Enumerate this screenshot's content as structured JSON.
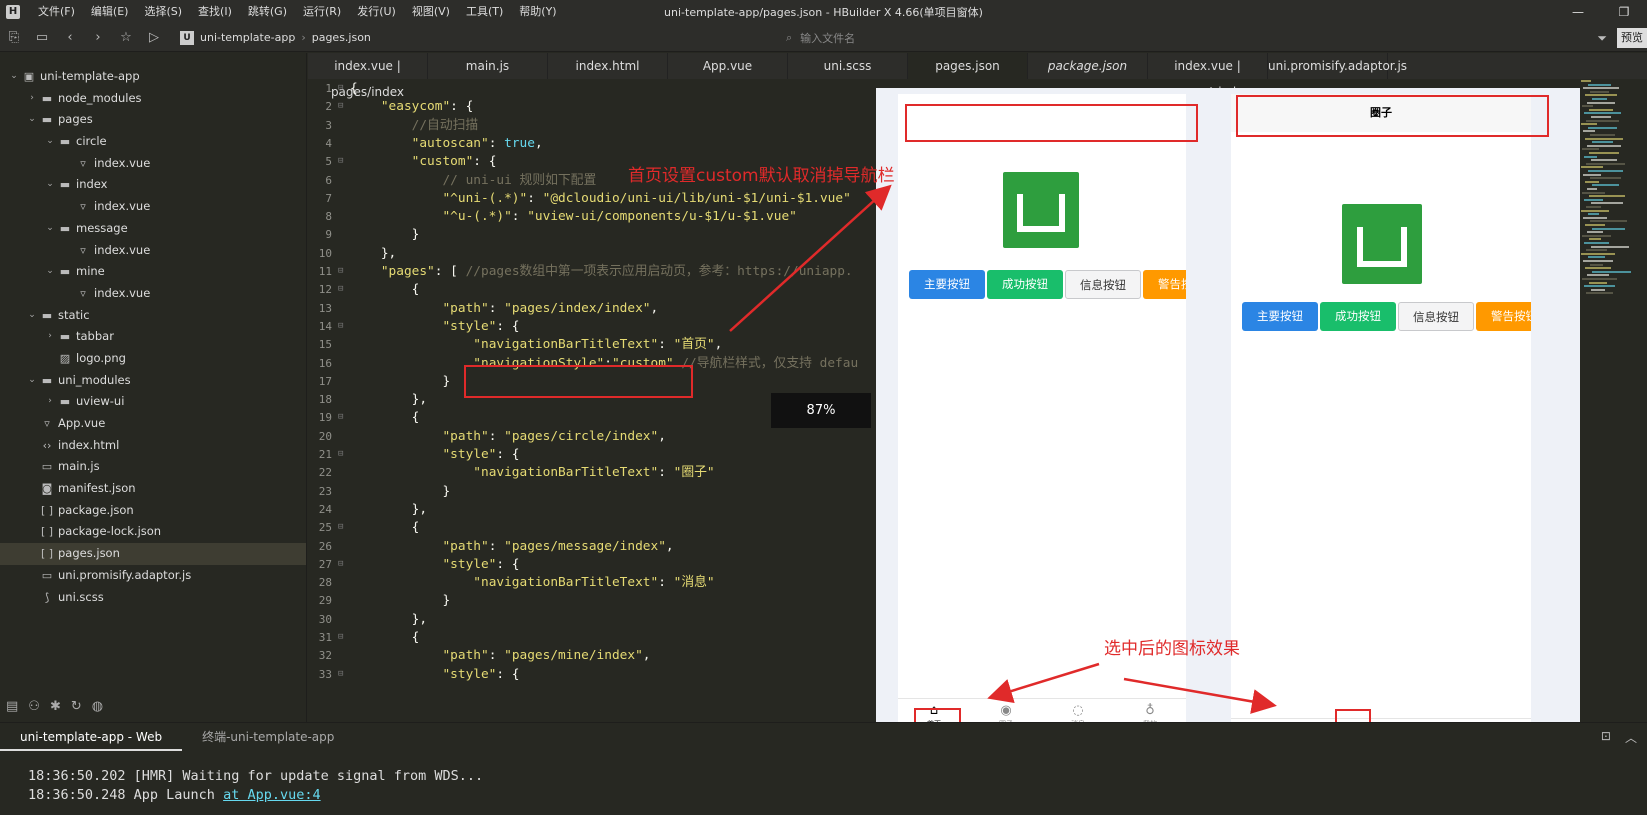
{
  "titlebar": {
    "app_icon": "H",
    "menu": [
      "文件(F)",
      "编辑(E)",
      "选择(S)",
      "查找(I)",
      "跳转(G)",
      "运行(R)",
      "发行(U)",
      "视图(V)",
      "工具(T)",
      "帮助(Y)"
    ],
    "title": "uni-template-app/pages.json - HBuilder X 4.66(单项目窗体)",
    "controls": [
      "—",
      "❐"
    ]
  },
  "toolbar": {
    "breadcrumb": [
      "uni-template-app",
      "pages.json"
    ],
    "search_placeholder": "输入文件名",
    "preview_label": "预览"
  },
  "sidebar": {
    "items": [
      {
        "label": "uni-template-app",
        "type": "project",
        "chevron": "⌄"
      },
      {
        "label": "node_modules",
        "type": "folder",
        "chevron": "›"
      },
      {
        "label": "pages",
        "type": "folder",
        "chevron": "⌄"
      },
      {
        "label": "circle",
        "type": "folder",
        "chevron": "⌄"
      },
      {
        "label": "index.vue",
        "type": "file",
        "icon": "vue"
      },
      {
        "label": "index",
        "type": "folder",
        "chevron": "⌄"
      },
      {
        "label": "index.vue",
        "type": "file",
        "icon": "vue"
      },
      {
        "label": "message",
        "type": "folder",
        "chevron": "⌄"
      },
      {
        "label": "index.vue",
        "type": "file",
        "icon": "vue"
      },
      {
        "label": "mine",
        "type": "folder",
        "chevron": "⌄"
      },
      {
        "label": "index.vue",
        "type": "file",
        "icon": "vue"
      },
      {
        "label": "static",
        "type": "folder",
        "chevron": "⌄"
      },
      {
        "label": "tabbar",
        "type": "folder",
        "chevron": "›"
      },
      {
        "label": "logo.png",
        "type": "file",
        "icon": "image"
      },
      {
        "label": "uni_modules",
        "type": "folder",
        "chevron": "⌄"
      },
      {
        "label": "uview-ui",
        "type": "folder",
        "chevron": "›"
      },
      {
        "label": "App.vue",
        "type": "file",
        "icon": "vue"
      },
      {
        "label": "index.html",
        "type": "file",
        "icon": "html"
      },
      {
        "label": "main.js",
        "type": "file",
        "icon": "js"
      },
      {
        "label": "manifest.json",
        "type": "file",
        "icon": "manifest"
      },
      {
        "label": "package.json",
        "type": "file",
        "icon": "json"
      },
      {
        "label": "package-lock.json",
        "type": "file",
        "icon": "json"
      },
      {
        "label": "pages.json",
        "type": "file",
        "icon": "json",
        "selected": true
      },
      {
        "label": "uni.promisify.adaptor.js",
        "type": "file",
        "icon": "js"
      },
      {
        "label": "uni.scss",
        "type": "file",
        "icon": "scss"
      }
    ]
  },
  "tabs": [
    {
      "label": "index.vue | pages/index"
    },
    {
      "label": "main.js"
    },
    {
      "label": "index.html"
    },
    {
      "label": "App.vue"
    },
    {
      "label": "uni.scss"
    },
    {
      "label": "pages.json",
      "active": true
    },
    {
      "label": "package.json",
      "italic": true
    },
    {
      "label": "index.vue | pages/circle"
    },
    {
      "label": "uni.promisify.adaptor.js"
    }
  ],
  "editor": {
    "lines": [
      {
        "n": "1",
        "fold": "⊟",
        "segs": [
          [
            "p",
            "{"
          ]
        ]
      },
      {
        "n": "2",
        "fold": "⊟",
        "segs": [
          [
            "p",
            "    "
          ],
          [
            "s",
            "\"easycom\""
          ],
          [
            "p",
            ": {"
          ]
        ]
      },
      {
        "n": "3",
        "fold": "",
        "segs": [
          [
            "c",
            "        //自动扫描"
          ]
        ]
      },
      {
        "n": "4",
        "fold": "",
        "segs": [
          [
            "p",
            "        "
          ],
          [
            "s",
            "\"autoscan\""
          ],
          [
            "p",
            ": "
          ],
          [
            "k",
            "true"
          ],
          [
            "p",
            ","
          ]
        ]
      },
      {
        "n": "5",
        "fold": "⊟",
        "segs": [
          [
            "p",
            "        "
          ],
          [
            "s",
            "\"custom\""
          ],
          [
            "p",
            ": {"
          ]
        ]
      },
      {
        "n": "6",
        "fold": "",
        "segs": [
          [
            "c",
            "            // uni-ui 规则如下配置"
          ]
        ]
      },
      {
        "n": "7",
        "fold": "",
        "segs": [
          [
            "p",
            "            "
          ],
          [
            "s",
            "\"^uni-(.*)\""
          ],
          [
            "p",
            ": "
          ],
          [
            "s",
            "\"@dcloudio/uni-ui/lib/uni-$1/uni-$1.vue\""
          ]
        ]
      },
      {
        "n": "8",
        "fold": "",
        "segs": [
          [
            "p",
            "            "
          ],
          [
            "s",
            "\"^u-(.*)\""
          ],
          [
            "p",
            ": "
          ],
          [
            "s",
            "\"uview-ui/components/u-$1/u-$1.vue\""
          ]
        ]
      },
      {
        "n": "9",
        "fold": "",
        "segs": [
          [
            "p",
            "        }"
          ]
        ]
      },
      {
        "n": "10",
        "fold": "",
        "segs": [
          [
            "p",
            "    },"
          ]
        ]
      },
      {
        "n": "11",
        "fold": "⊟",
        "segs": [
          [
            "p",
            "    "
          ],
          [
            "s",
            "\"pages\""
          ],
          [
            "p",
            ": [ "
          ],
          [
            "c",
            "//pages数组中第一项表示应用启动页，参考：https://uniapp."
          ]
        ]
      },
      {
        "n": "12",
        "fold": "⊟",
        "segs": [
          [
            "p",
            "        {"
          ]
        ]
      },
      {
        "n": "13",
        "fold": "",
        "segs": [
          [
            "p",
            "            "
          ],
          [
            "s",
            "\"path\""
          ],
          [
            "p",
            ": "
          ],
          [
            "s",
            "\"pages/index/index\""
          ],
          [
            "p",
            ","
          ]
        ]
      },
      {
        "n": "14",
        "fold": "⊟",
        "segs": [
          [
            "p",
            "            "
          ],
          [
            "s",
            "\"style\""
          ],
          [
            "p",
            ": {"
          ]
        ]
      },
      {
        "n": "15",
        "fold": "",
        "segs": [
          [
            "p",
            "                "
          ],
          [
            "s",
            "\"navigationBarTitleText\""
          ],
          [
            "p",
            ": "
          ],
          [
            "s",
            "\"首页\""
          ],
          [
            "p",
            ","
          ]
        ]
      },
      {
        "n": "16",
        "fold": "",
        "segs": [
          [
            "p",
            "                "
          ],
          [
            "s",
            "\"navigationStyle\""
          ],
          [
            "p",
            ":"
          ],
          [
            "s",
            "\"custom\""
          ],
          [
            "p",
            " "
          ],
          [
            "c",
            "//导航栏样式，仅支持 defau"
          ]
        ]
      },
      {
        "n": "17",
        "fold": "",
        "segs": [
          [
            "p",
            "            }"
          ]
        ]
      },
      {
        "n": "18",
        "fold": "",
        "segs": [
          [
            "p",
            "        },"
          ]
        ]
      },
      {
        "n": "19",
        "fold": "⊟",
        "segs": [
          [
            "p",
            "        {"
          ]
        ]
      },
      {
        "n": "20",
        "fold": "",
        "segs": [
          [
            "p",
            "            "
          ],
          [
            "s",
            "\"path\""
          ],
          [
            "p",
            ": "
          ],
          [
            "s",
            "\"pages/circle/index\""
          ],
          [
            "p",
            ","
          ]
        ]
      },
      {
        "n": "21",
        "fold": "⊟",
        "segs": [
          [
            "p",
            "            "
          ],
          [
            "s",
            "\"style\""
          ],
          [
            "p",
            ": {"
          ]
        ]
      },
      {
        "n": "22",
        "fold": "",
        "segs": [
          [
            "p",
            "                "
          ],
          [
            "s",
            "\"navigationBarTitleText\""
          ],
          [
            "p",
            ": "
          ],
          [
            "s",
            "\"圈子\""
          ]
        ]
      },
      {
        "n": "23",
        "fold": "",
        "segs": [
          [
            "p",
            "            }"
          ]
        ]
      },
      {
        "n": "24",
        "fold": "",
        "segs": [
          [
            "p",
            "        },"
          ]
        ]
      },
      {
        "n": "25",
        "fold": "⊟",
        "segs": [
          [
            "p",
            "        {"
          ]
        ]
      },
      {
        "n": "26",
        "fold": "",
        "segs": [
          [
            "p",
            "            "
          ],
          [
            "s",
            "\"path\""
          ],
          [
            "p",
            ": "
          ],
          [
            "s",
            "\"pages/message/index\""
          ],
          [
            "p",
            ","
          ]
        ]
      },
      {
        "n": "27",
        "fold": "⊟",
        "segs": [
          [
            "p",
            "            "
          ],
          [
            "s",
            "\"style\""
          ],
          [
            "p",
            ": {"
          ]
        ]
      },
      {
        "n": "28",
        "fold": "",
        "segs": [
          [
            "p",
            "                "
          ],
          [
            "s",
            "\"navigationBarTitleText\""
          ],
          [
            "p",
            ": "
          ],
          [
            "s",
            "\"消息\""
          ]
        ]
      },
      {
        "n": "29",
        "fold": "",
        "segs": [
          [
            "p",
            "            }"
          ]
        ]
      },
      {
        "n": "30",
        "fold": "",
        "segs": [
          [
            "p",
            "        },"
          ]
        ]
      },
      {
        "n": "31",
        "fold": "⊟",
        "segs": [
          [
            "p",
            "        {"
          ]
        ]
      },
      {
        "n": "32",
        "fold": "",
        "segs": [
          [
            "p",
            "            "
          ],
          [
            "s",
            "\"path\""
          ],
          [
            "p",
            ": "
          ],
          [
            "s",
            "\"pages/mine/index\""
          ],
          [
            "p",
            ","
          ]
        ]
      },
      {
        "n": "33",
        "fold": "⊟",
        "segs": [
          [
            "p",
            "            "
          ],
          [
            "s",
            "\"style\""
          ],
          [
            "p",
            ": {"
          ]
        ]
      }
    ]
  },
  "preview": {
    "phone_right_title": "圈子",
    "buttons": [
      "主要按钮",
      "成功按钮",
      "信息按钮",
      "警告按钮"
    ],
    "tabbar": [
      "首页",
      "圈子",
      "消息",
      "我的"
    ],
    "annotation_top": "首页设置custom默认取消掉导航栏",
    "annotation_bottom": "选中后的图标效果",
    "zoom": "87%"
  },
  "bottom_panel": {
    "tabs": [
      "uni-template-app - Web",
      "终端-uni-template-app"
    ],
    "logs": [
      {
        "text": "18:36:50.202 [HMR] Waiting for update signal from WDS...",
        "link": ""
      },
      {
        "text": "18:36:50.248 App Launch ",
        "link": "at App.vue:4"
      }
    ]
  },
  "colors": {
    "accent_red": "#e02a2a",
    "logo_green": "#2e9e3e",
    "editor_bg": "#272822"
  }
}
